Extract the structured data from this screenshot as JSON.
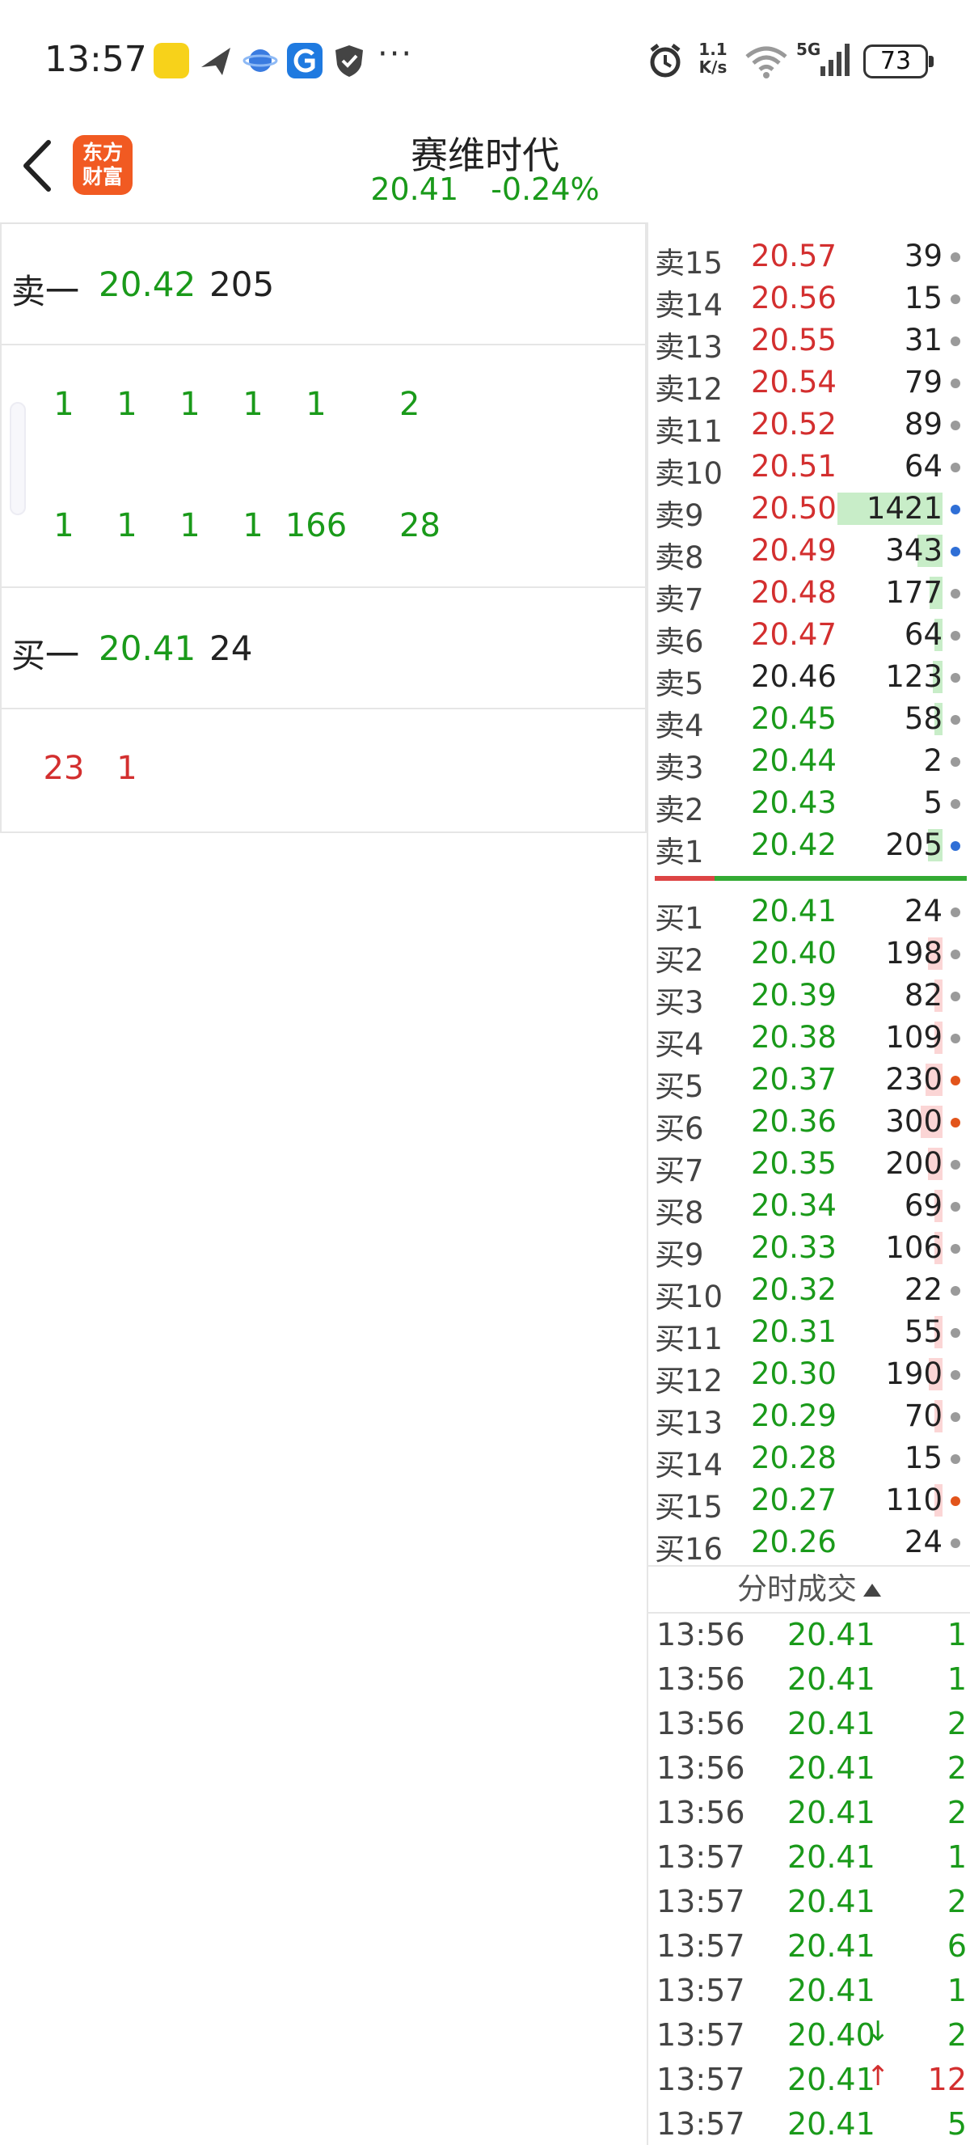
{
  "status_bar": {
    "time": "13:57",
    "net_speed_value": "1.1",
    "net_speed_unit": "K/s",
    "battery": "73",
    "more": "···"
  },
  "header": {
    "stock_name": "赛维时代",
    "price": "20.41",
    "change_pct": "-0.24%",
    "logo_line1": "东方",
    "logo_line2": "财富"
  },
  "left_panel": {
    "ask1": {
      "label": "卖一",
      "price": "20.42",
      "volume": "205"
    },
    "ask_queue_row1": [
      "1",
      "1",
      "1",
      "1",
      "1",
      "2"
    ],
    "ask_queue_row2": [
      "1",
      "1",
      "1",
      "1",
      "166",
      "28"
    ],
    "bid1": {
      "label": "买一",
      "price": "20.41",
      "volume": "24"
    },
    "bid_queue_row1": [
      "23",
      "1"
    ]
  },
  "depth": {
    "asks": [
      {
        "label": "卖15",
        "price": "20.57",
        "volume": "39",
        "bar": 0.0,
        "dot": "gray",
        "color": "red"
      },
      {
        "label": "卖14",
        "price": "20.56",
        "volume": "15",
        "bar": 0.0,
        "dot": "gray",
        "color": "red"
      },
      {
        "label": "卖13",
        "price": "20.55",
        "volume": "31",
        "bar": 0.0,
        "dot": "gray",
        "color": "red"
      },
      {
        "label": "卖12",
        "price": "20.54",
        "volume": "79",
        "bar": 0.0,
        "dot": "gray",
        "color": "red"
      },
      {
        "label": "卖11",
        "price": "20.52",
        "volume": "89",
        "bar": 0.0,
        "dot": "gray",
        "color": "red"
      },
      {
        "label": "卖10",
        "price": "20.51",
        "volume": "64",
        "bar": 0.0,
        "dot": "gray",
        "color": "red"
      },
      {
        "label": "卖9",
        "price": "20.50",
        "volume": "1421",
        "bar": 1.0,
        "dot": "blue",
        "color": "red"
      },
      {
        "label": "卖8",
        "price": "20.49",
        "volume": "343",
        "bar": 0.24,
        "dot": "blue",
        "color": "red"
      },
      {
        "label": "卖7",
        "price": "20.48",
        "volume": "177",
        "bar": 0.12,
        "dot": "gray",
        "color": "red"
      },
      {
        "label": "卖6",
        "price": "20.47",
        "volume": "64",
        "bar": 0.04,
        "dot": "gray",
        "color": "red"
      },
      {
        "label": "卖5",
        "price": "20.46",
        "volume": "123",
        "bar": 0.09,
        "dot": "gray",
        "color": "black"
      },
      {
        "label": "卖4",
        "price": "20.45",
        "volume": "58",
        "bar": 0.04,
        "dot": "gray",
        "color": "green"
      },
      {
        "label": "卖3",
        "price": "20.44",
        "volume": "2",
        "bar": 0.0,
        "dot": "gray",
        "color": "green"
      },
      {
        "label": "卖2",
        "price": "20.43",
        "volume": "5",
        "bar": 0.0,
        "dot": "gray",
        "color": "green"
      },
      {
        "label": "卖1",
        "price": "20.42",
        "volume": "205",
        "bar": 0.14,
        "dot": "blue",
        "color": "green"
      }
    ],
    "bids": [
      {
        "label": "买1",
        "price": "20.41",
        "volume": "24",
        "bar": 0.0,
        "dot": "gray",
        "color": "green"
      },
      {
        "label": "买2",
        "price": "20.40",
        "volume": "198",
        "bar": 0.14,
        "dot": "gray",
        "color": "green"
      },
      {
        "label": "买3",
        "price": "20.39",
        "volume": "82",
        "bar": 0.06,
        "dot": "gray",
        "color": "green"
      },
      {
        "label": "买4",
        "price": "20.38",
        "volume": "109",
        "bar": 0.08,
        "dot": "gray",
        "color": "green"
      },
      {
        "label": "买5",
        "price": "20.37",
        "volume": "230",
        "bar": 0.16,
        "dot": "orange",
        "color": "green"
      },
      {
        "label": "买6",
        "price": "20.36",
        "volume": "300",
        "bar": 0.21,
        "dot": "orange",
        "color": "green"
      },
      {
        "label": "买7",
        "price": "20.35",
        "volume": "200",
        "bar": 0.14,
        "dot": "gray",
        "color": "green"
      },
      {
        "label": "买8",
        "price": "20.34",
        "volume": "69",
        "bar": 0.05,
        "dot": "gray",
        "color": "green"
      },
      {
        "label": "买9",
        "price": "20.33",
        "volume": "106",
        "bar": 0.07,
        "dot": "gray",
        "color": "green"
      },
      {
        "label": "买10",
        "price": "20.32",
        "volume": "22",
        "bar": 0.0,
        "dot": "gray",
        "color": "green"
      },
      {
        "label": "买11",
        "price": "20.31",
        "volume": "55",
        "bar": 0.04,
        "dot": "gray",
        "color": "green"
      },
      {
        "label": "买12",
        "price": "20.30",
        "volume": "190",
        "bar": 0.13,
        "dot": "gray",
        "color": "green"
      },
      {
        "label": "买13",
        "price": "20.29",
        "volume": "70",
        "bar": 0.05,
        "dot": "gray",
        "color": "green"
      },
      {
        "label": "买14",
        "price": "20.28",
        "volume": "15",
        "bar": 0.0,
        "dot": "gray",
        "color": "green"
      },
      {
        "label": "买15",
        "price": "20.27",
        "volume": "110",
        "bar": 0.08,
        "dot": "orange",
        "color": "green"
      },
      {
        "label": "买16",
        "price": "20.26",
        "volume": "24",
        "bar": 0.0,
        "dot": "gray",
        "color": "green"
      }
    ]
  },
  "ticks": {
    "title": "分时成交",
    "rows": [
      {
        "time": "13:56",
        "price": "20.41",
        "arrow": "",
        "volume": "1",
        "vol_color": "green"
      },
      {
        "time": "13:56",
        "price": "20.41",
        "arrow": "",
        "volume": "1",
        "vol_color": "green"
      },
      {
        "time": "13:56",
        "price": "20.41",
        "arrow": "",
        "volume": "2",
        "vol_color": "green"
      },
      {
        "time": "13:56",
        "price": "20.41",
        "arrow": "",
        "volume": "2",
        "vol_color": "green"
      },
      {
        "time": "13:56",
        "price": "20.41",
        "arrow": "",
        "volume": "2",
        "vol_color": "green"
      },
      {
        "time": "13:57",
        "price": "20.41",
        "arrow": "",
        "volume": "1",
        "vol_color": "green"
      },
      {
        "time": "13:57",
        "price": "20.41",
        "arrow": "",
        "volume": "2",
        "vol_color": "green"
      },
      {
        "time": "13:57",
        "price": "20.41",
        "arrow": "",
        "volume": "6",
        "vol_color": "green"
      },
      {
        "time": "13:57",
        "price": "20.41",
        "arrow": "",
        "volume": "1",
        "vol_color": "green"
      },
      {
        "time": "13:57",
        "price": "20.40",
        "arrow": "↓",
        "volume": "2",
        "vol_color": "green"
      },
      {
        "time": "13:57",
        "price": "20.41",
        "arrow": "↑",
        "volume": "12",
        "vol_color": "red"
      },
      {
        "time": "13:57",
        "price": "20.41",
        "arrow": "",
        "volume": "5",
        "vol_color": "green"
      }
    ]
  },
  "colors": {
    "green": "#1a9a1a",
    "red": "#d32f2f",
    "black": "#222222",
    "dot_gray": "#9a9a9a",
    "dot_blue": "#2f6fd6",
    "dot_orange": "#e2541b",
    "brand": "#f15a22"
  }
}
